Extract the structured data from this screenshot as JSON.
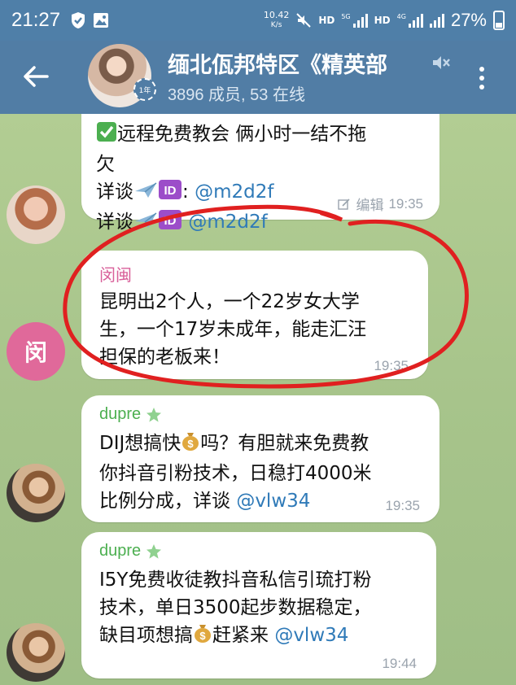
{
  "status_bar": {
    "time": "21:27",
    "net_speed_value": "10.42",
    "net_speed_unit": "K/s",
    "hd1": "HD",
    "net1": "5G",
    "hd2": "HD",
    "net2": "4G",
    "battery": "27%"
  },
  "header": {
    "title": "缅北佤邦特区《精英部",
    "subtitle": "3896 成员, 53 在线",
    "story_badge": "1年"
  },
  "messages": [
    {
      "line1": "远程免费教会 俩小时一结不拖",
      "line2": "欠",
      "line3_prefix": "详谈",
      "line3_sep": ":",
      "line3_handle": "@m2d2f",
      "line4_prefix": "详谈",
      "line4_handle": "@m2d2f",
      "edited": "编辑",
      "time": "19:35"
    },
    {
      "sender": "闵闽",
      "line1": "昆明出2个人，一个22岁女大学",
      "line2": "生，一个17岁未成年，能走汇汪",
      "line3": "担保的老板来！",
      "time": "19:35",
      "avatar_letter": "闵"
    },
    {
      "sender": "dupre",
      "line1a": "DIJ想搞快",
      "line1b": "吗？有胆就来免费教",
      "line2": "你抖音引粉技术，日稳打4000米",
      "line3": "比例分成，详谈",
      "line3_handle": "@vlw34",
      "time": "19:35"
    },
    {
      "sender": "dupre",
      "line1": "I5Y免费收徒教抖音私信引琉打粉",
      "line2": "技术，单日3500起步数据稳定，",
      "line3a": "缺目项想搞",
      "line3b": "赶紧来",
      "line3_handle": "@vlw34",
      "time": "19:44"
    }
  ],
  "colors": {
    "header": "#517da5",
    "status_bar": "#4f7fa8",
    "chat_bg": "#a9c78f",
    "sender_pink": "#d9609a",
    "sender_green": "#4caf50",
    "link": "#2f7ab8",
    "annotation_red": "#e02020"
  },
  "icons": [
    "back-arrow-icon",
    "mute-icon",
    "more-vert-icon",
    "check-emoji-icon",
    "airplane-emoji-icon",
    "id-emoji-icon",
    "money-bag-emoji-icon",
    "star-icon",
    "shield-icon",
    "image-icon",
    "wifi-icon",
    "signal-icon",
    "battery-icon"
  ]
}
